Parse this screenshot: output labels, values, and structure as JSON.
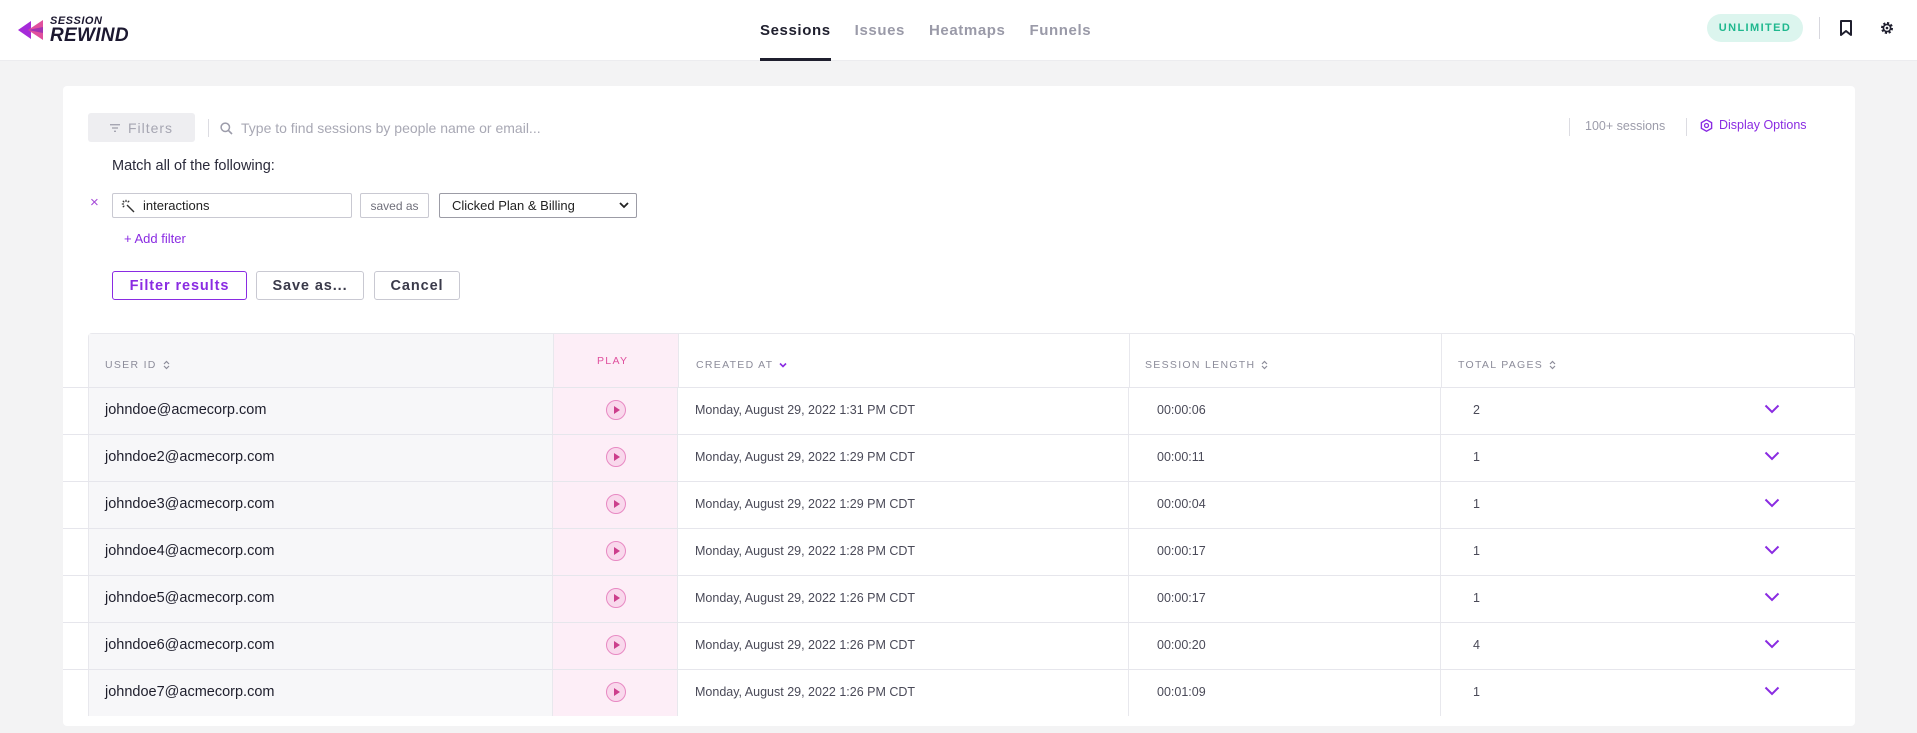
{
  "brand": {
    "line1": "SESSION",
    "line2": "REWIND",
    "colors": {
      "primary": "#8a2be2",
      "pink": "#e0509e"
    }
  },
  "nav": {
    "tabs": [
      {
        "label": "Sessions",
        "active": true
      },
      {
        "label": "Issues",
        "active": false
      },
      {
        "label": "Heatmaps",
        "active": false
      },
      {
        "label": "Funnels",
        "active": false
      }
    ]
  },
  "header": {
    "badge": "UNLIMITED",
    "icons": [
      "bookmark-icon",
      "gear-icon"
    ]
  },
  "toolbar": {
    "filters_label": "Filters",
    "search_placeholder": "Type to find sessions by people name or email...",
    "sessions_count": "100+ sessions",
    "display_options": "Display Options"
  },
  "filter_panel": {
    "match_label": "Match all of the following:",
    "remove_symbol": "×",
    "field_value": "interactions",
    "operator": "saved as",
    "selected_value": "Clicked Plan & Billing",
    "add_filter": "+ Add filter",
    "filter_results": "Filter results",
    "save_as": "Save as...",
    "cancel": "Cancel"
  },
  "table": {
    "headers": {
      "user_id": "USER ID",
      "play": "PLAY",
      "created_at": "CREATED AT",
      "session_length": "SESSION LENGTH",
      "total_pages": "TOTAL PAGES"
    },
    "rows": [
      {
        "user": "johndoe@acmecorp.com",
        "created": "Monday, August 29, 2022 1:31 PM CDT",
        "length": "00:00:06",
        "pages": "2"
      },
      {
        "user": "johndoe2@acmecorp.com",
        "created": "Monday, August 29, 2022 1:29 PM CDT",
        "length": "00:00:11",
        "pages": "1"
      },
      {
        "user": "johndoe3@acmecorp.com",
        "created": "Monday, August 29, 2022 1:29 PM CDT",
        "length": "00:00:04",
        "pages": "1"
      },
      {
        "user": "johndoe4@acmecorp.com",
        "created": "Monday, August 29, 2022 1:28 PM CDT",
        "length": "00:00:17",
        "pages": "1"
      },
      {
        "user": "johndoe5@acmecorp.com",
        "created": "Monday, August 29, 2022 1:26 PM CDT",
        "length": "00:00:17",
        "pages": "1"
      },
      {
        "user": "johndoe6@acmecorp.com",
        "created": "Monday, August 29, 2022 1:26 PM CDT",
        "length": "00:00:20",
        "pages": "4"
      },
      {
        "user": "johndoe7@acmecorp.com",
        "created": "Monday, August 29, 2022 1:26 PM CDT",
        "length": "00:01:09",
        "pages": "1"
      }
    ]
  }
}
